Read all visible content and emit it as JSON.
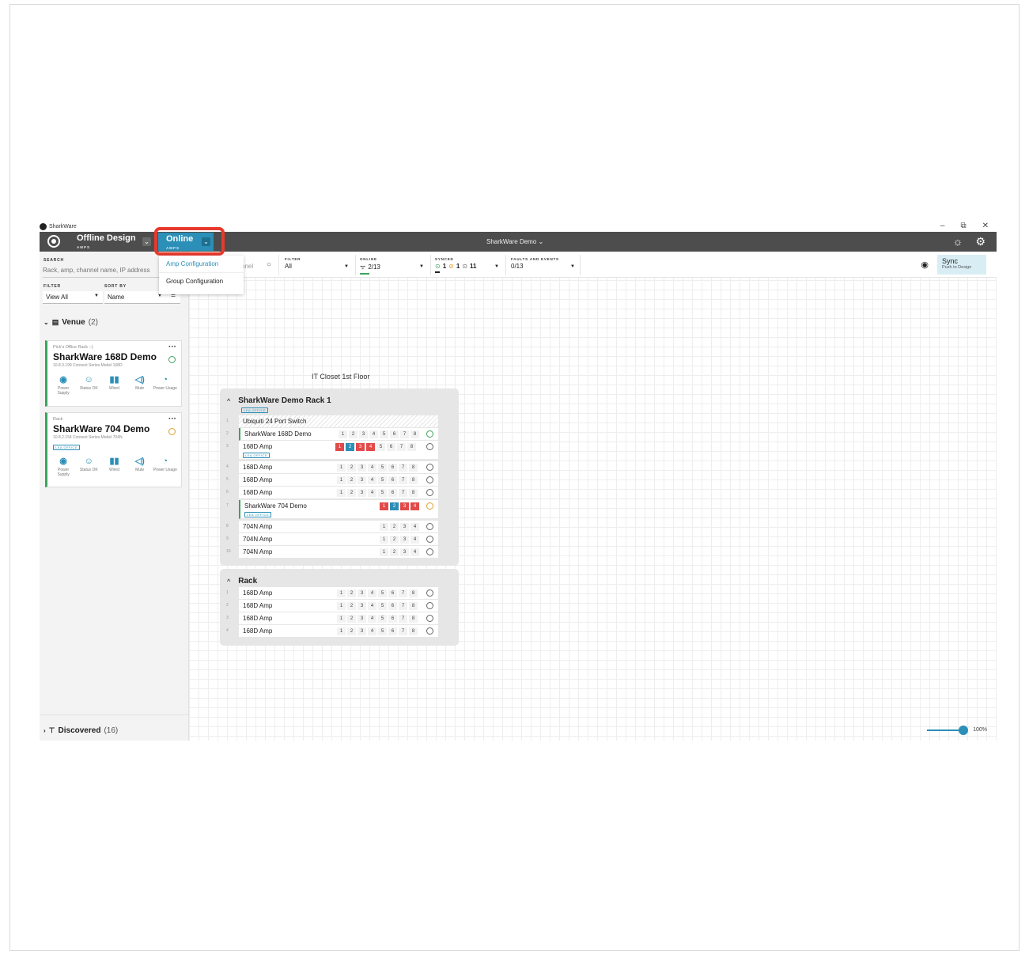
{
  "window": {
    "app_name": "SharkWare",
    "minimize": "–",
    "restore": "⧉",
    "close": "✕"
  },
  "header": {
    "offline_label": "Offline Design",
    "offline_sub": "AMPS",
    "online_label": "Online",
    "online_sub": "AMPS",
    "project": "SharkWare Demo ⌄",
    "caret": "⌄"
  },
  "dropdown": {
    "items": [
      "Amp Configuration",
      "Group Configuration"
    ]
  },
  "left": {
    "search_label": "SEARCH",
    "search_placeholder": "Rack, amp, channel name, IP address",
    "filter_label": "FILTER",
    "filter_value": "View All",
    "sort_label": "SORT BY",
    "sort_value": "Name",
    "venue_label": "Venue",
    "venue_count": "(2)",
    "discovered_label": "Discovered",
    "discovered_count": "(16)",
    "cards": [
      {
        "sub": "Pick's Office Rack :-)",
        "name": "SharkWare 168D Demo",
        "meta": "10.8.3.199  Connect Series Model 168D",
        "tag": ""
      },
      {
        "sub": "Rack",
        "name": "SharkWare 704 Demo",
        "meta": "10.8.2.154  Connect Series Model 704N",
        "tag": "LEA OFFICE"
      }
    ],
    "icon_labels": {
      "power": "Power Supply",
      "status": "Status OK",
      "wired": "Wired",
      "mute": "Mute",
      "usage": "Power Usage"
    }
  },
  "toolbar": {
    "search_partial": "nnel",
    "filter_label": "FILTER",
    "filter_value": "All",
    "online_label": "ONLINE",
    "online_value": "2/13",
    "synced_label": "SYNCED",
    "synced_values": [
      "1",
      "1",
      "11"
    ],
    "faults_label": "FAULTS AND EVENTS",
    "faults_value": "0/13",
    "sync_label": "Sync",
    "sync_sub": "Push to Design",
    "zoom": "100%"
  },
  "canvas": {
    "closet_title": "IT Closet 1st Floor",
    "rack1": {
      "title": "SharkWare Demo Rack 1",
      "tag": "LEA OFFICE",
      "rows": [
        {
          "n": "1",
          "name": "Ubiquiti 24 Port Switch"
        },
        {
          "n": "2",
          "name": "SharkWare 168D Demo"
        },
        {
          "n": "3",
          "name": "168D Amp",
          "tag": "LEA OFFICE"
        },
        {
          "n": "4",
          "name": "168D Amp"
        },
        {
          "n": "5",
          "name": "168D Amp"
        },
        {
          "n": "6",
          "name": "168D Amp"
        },
        {
          "n": "7",
          "name": "SharkWare 704 Demo",
          "tag": "LEA OFFICE"
        },
        {
          "n": "8",
          "name": "704N Amp"
        },
        {
          "n": "9",
          "name": "704N Amp"
        },
        {
          "n": "10",
          "name": "704N Amp"
        }
      ]
    },
    "rack2": {
      "title": "Rack",
      "rows": [
        {
          "n": "1",
          "name": "168D Amp"
        },
        {
          "n": "2",
          "name": "168D Amp"
        },
        {
          "n": "3",
          "name": "168D Amp"
        },
        {
          "n": "4",
          "name": "168D Amp"
        }
      ]
    },
    "channels8": [
      "1",
      "2",
      "3",
      "4",
      "5",
      "6",
      "7",
      "8"
    ],
    "channels4": [
      "1",
      "2",
      "3",
      "4"
    ]
  },
  "colors": {
    "accent": "#2b8fb7",
    "ok": "#3aa55c",
    "warn": "#e0a030",
    "fault": "#e24a4a",
    "highlight": "#e8392d"
  }
}
